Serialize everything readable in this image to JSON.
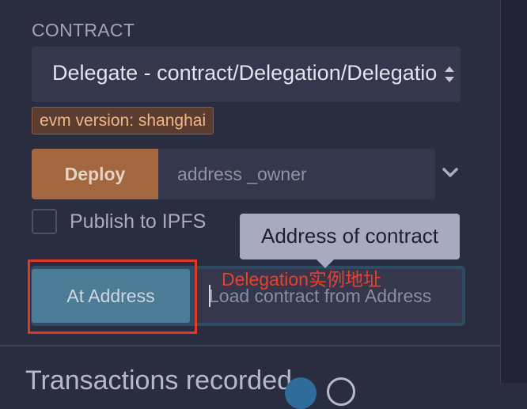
{
  "contract_section": {
    "label": "CONTRACT",
    "selected_contract": "Delegate - contract/Delegation/Delegation.sol"
  },
  "evm_badge": "evm version: shanghai",
  "deploy": {
    "button_label": "Deploy",
    "owner_placeholder": "address _owner"
  },
  "publish": {
    "label": "Publish to IPFS",
    "checked": false
  },
  "tooltip": "Address of contract",
  "at_address": {
    "button_label": "At Address",
    "input_placeholder": "Load contract from Address"
  },
  "annotation": "Delegation实例地址",
  "bottom_heading": "Transactions recorded",
  "colors": {
    "panel_bg": "#2a2c3f",
    "input_bg": "#35384c",
    "deploy_orange": "#a2673f",
    "at_address_blue": "#4d7c97",
    "annotation_red": "#e03a27",
    "badge_text": "#f0b588"
  },
  "icons": [
    "select-arrows-icon",
    "chevron-down-icon",
    "info-icon",
    "help-icon"
  ]
}
